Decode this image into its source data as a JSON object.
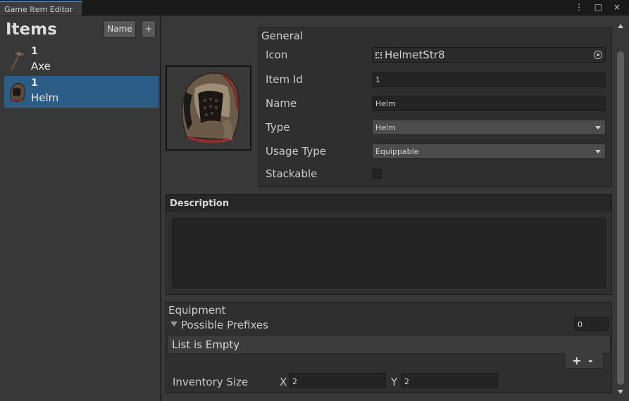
{
  "window": {
    "tab_title": "Game Item Editor",
    "controls": "⋮ □ ×"
  },
  "left": {
    "title": "Items",
    "sort_button": "Name",
    "add_button": "+",
    "items": [
      {
        "count": "1",
        "name": "Axe",
        "icon": "axe-icon",
        "selected": false
      },
      {
        "count": "1",
        "name": "Helm",
        "icon": "helm-icon",
        "selected": true
      }
    ]
  },
  "general": {
    "header": "General",
    "icon_label": "Icon",
    "icon_value": "HelmetStr8",
    "item_id_label": "Item Id",
    "item_id_value": "1",
    "name_label": "Name",
    "name_value": "Helm",
    "type_label": "Type",
    "type_value": "Helm",
    "usage_label": "Usage Type",
    "usage_value": "Equippable",
    "stackable_label": "Stackable",
    "stackable_checked": false
  },
  "description": {
    "header": "Description",
    "value": ""
  },
  "equipment": {
    "header": "Equipment",
    "prefixes_label": "Possible Prefixes",
    "prefixes_count": "0",
    "empty_text": "List is Empty",
    "add_btn": "+",
    "remove_btn": "-",
    "inventory_label": "Inventory Size",
    "x_label": "X",
    "x_value": "2",
    "y_label": "Y",
    "y_value": "2"
  },
  "colors": {
    "selection": "#2c5d87",
    "tab_accent": "#3a79bb",
    "panel": "#383838"
  }
}
